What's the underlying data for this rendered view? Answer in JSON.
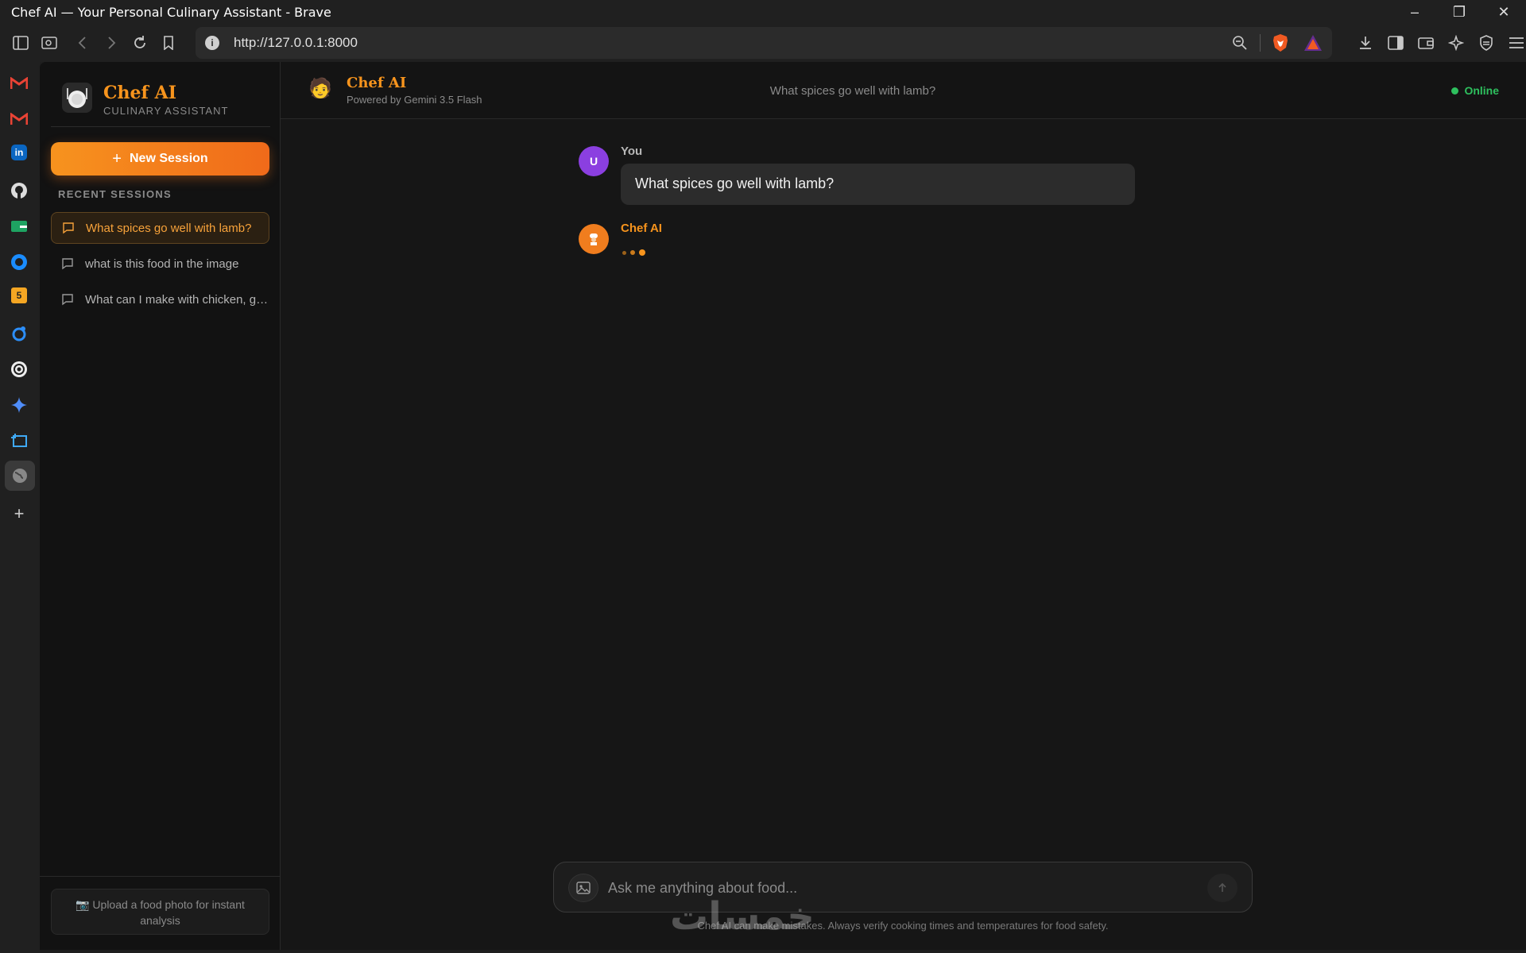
{
  "window": {
    "title": "Chef AI — Your Personal Culinary Assistant - Brave"
  },
  "browser": {
    "url": "http://127.0.0.1:8000",
    "sidebar_icons": [
      "gmail-icon",
      "gmail-icon",
      "linkedin-icon",
      "github-icon",
      "green-app-icon",
      "circle-app-icon",
      "html5-icon",
      "swirl-app-icon",
      "openai-icon",
      "gemini-icon",
      "frame-app-icon",
      "globe-icon",
      "add-icon"
    ]
  },
  "sidebar": {
    "brand_name": "Chef AI",
    "brand_sub": "CULINARY ASSISTANT",
    "new_session_label": "New Session",
    "recent_label": "RECENT SESSIONS",
    "sessions": [
      {
        "label": "What spices go well with lamb?",
        "active": true
      },
      {
        "label": "what is this food in the image",
        "active": false
      },
      {
        "label": "What can I make with chicken, garlic and lemon?",
        "active": false
      }
    ],
    "upload_hint": "Upload a food photo for instant analysis"
  },
  "header": {
    "name": "Chef AI",
    "powered_by": "Powered by Gemini 3.5 Flash",
    "session_title": "What spices go well with lamb?",
    "status": "Online"
  },
  "messages": [
    {
      "author": "You",
      "avatar": "U",
      "text": "What spices go well with lamb?"
    },
    {
      "author": "Chef AI",
      "typing": true
    }
  ],
  "composer": {
    "placeholder": "Ask me anything about food...",
    "disclaimer": "Chef AI can make mistakes. Always verify cooking times and temperatures for food safety."
  },
  "colors": {
    "accent": "#f7941d",
    "user_avatar": "#8b3fe0",
    "online": "#2ec05e"
  },
  "watermark": "خمسات"
}
